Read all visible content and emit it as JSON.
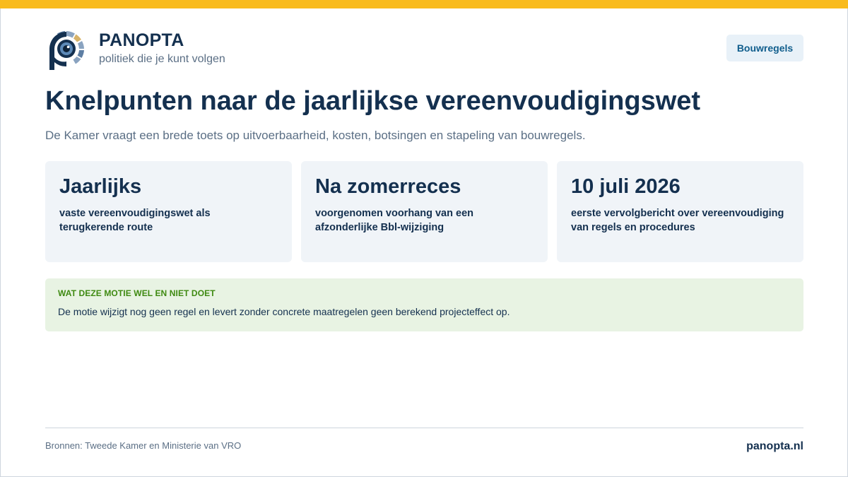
{
  "colors": {
    "accent_bar": "#f9bb1d",
    "navy": "#14304f",
    "muted": "#5b6f85",
    "card_bg": "#f0f4f8",
    "note_bg": "#e8f3e3",
    "note_label": "#3f8a12",
    "tag_bg": "#e8f1f8",
    "tag_text": "#0f5d8c"
  },
  "brand": {
    "logo_icon": "eye-p-logo",
    "name": "PANOPTA",
    "tagline": "politiek die je kunt volgen"
  },
  "topic_tag": "Bouwregels",
  "title": "Knelpunten naar de jaarlijkse vereenvoudigingswet",
  "subtitle": "De Kamer vraagt een brede toets op uitvoerbaarheid, kosten, botsingen en stapeling van bouwregels.",
  "cards": [
    {
      "value": "Jaarlijks",
      "description": "vaste vereenvoudigingswet als terugkerende route"
    },
    {
      "value": "Na zomerreces",
      "description": "voorgenomen voorhang van een afzonderlijke Bbl-wijziging"
    },
    {
      "value": "10 juli 2026",
      "description": "eerste vervolgbericht over vereenvoudiging van regels en procedures"
    }
  ],
  "note": {
    "label": "WAT DEZE MOTIE WEL EN NIET DOET",
    "text": "De motie wijzigt nog geen regel en levert zonder concrete maatregelen geen berekend projecteffect op."
  },
  "footer": {
    "sources": "Bronnen: Tweede Kamer en Ministerie van VRO",
    "site": "panopta.nl"
  }
}
